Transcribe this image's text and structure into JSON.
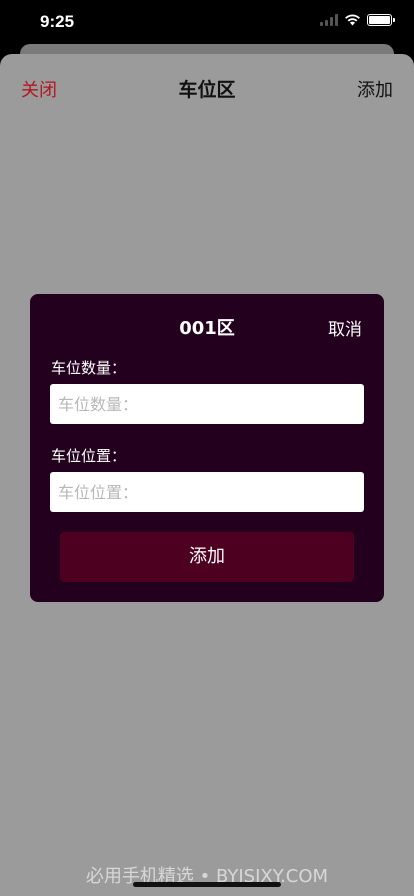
{
  "status_bar": {
    "time": "9:25",
    "icons": [
      "signal-icon",
      "wifi-icon",
      "battery-icon"
    ]
  },
  "nav": {
    "close_label": "关闭",
    "title": "车位区",
    "add_label": "添加"
  },
  "dialog": {
    "title": "001区",
    "cancel_label": "取消",
    "fields": [
      {
        "label": "车位数量：",
        "placeholder": "车位数量：",
        "value": ""
      },
      {
        "label": "车位位置：",
        "placeholder": "车位位置：",
        "value": ""
      }
    ],
    "submit_label": "添加"
  },
  "watermark": "必用手机精选 • BYJSJXY.COM",
  "colors": {
    "accent_red": "#b3161f",
    "dialog_bg": "#22001e",
    "button_bg": "#4e0020",
    "sheet_bg": "#9b9b9b"
  }
}
